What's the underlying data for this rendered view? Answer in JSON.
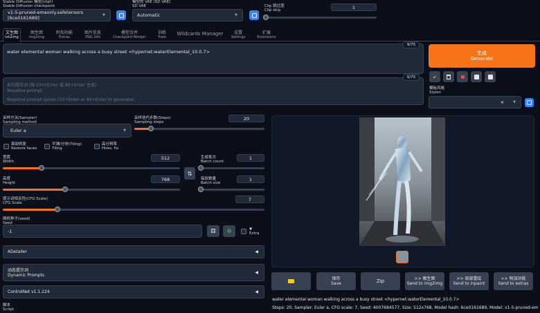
{
  "top": {
    "checkpoint_label_zh": "Stable Diffusion 模型(ckpt)",
    "checkpoint_label_en": "Stable Diffusion checkpoint",
    "checkpoint_value": "v1-5-pruned-emaonly.safetensors [6ce0161689]",
    "vae_label_zh": "模型的 VAE (SD VAE)",
    "vae_label_en": "SD VAE",
    "vae_value": "Automatic",
    "clip_label_zh": "Clip 跳过层",
    "clip_label_en": "Clip skip",
    "clip_value": "1",
    "clip_level": 0
  },
  "tabs": [
    {
      "zh": "文生图",
      "en": "txt2img"
    },
    {
      "zh": "图生图",
      "en": "img2img"
    },
    {
      "zh": "附加功能",
      "en": "Extras"
    },
    {
      "zh": "图片信息",
      "en": "PNG Info"
    },
    {
      "zh": "模型合并",
      "en": "Checkpoint Merger"
    },
    {
      "zh": "训练",
      "en": "Train"
    },
    {
      "zh": "Wildcards Manager",
      "en": ""
    },
    {
      "zh": "设置",
      "en": "Settings"
    },
    {
      "zh": "扩展",
      "en": "Extensions"
    }
  ],
  "prompt": {
    "text": "water elemental woman walking across a busy street <hypernet:waterElemental_10.0.7>",
    "counter": "9/75"
  },
  "negative": {
    "placeholder_zh": "反向提示词 (按 Ctrl+Enter 或 Alt+Enter 生成)",
    "placeholder_en": "Negative prompt",
    "hint": "Negative prompt (press Ctrl+Enter or Alt+Enter to generate)",
    "counter": "0/75"
  },
  "generate": {
    "zh": "生成",
    "en": "Generate",
    "color": "#f97316"
  },
  "styles": {
    "zh": "模板风格",
    "en": "Styles"
  },
  "sampling": {
    "method_zh": "采样方法(Sampler)",
    "method_en": "Sampling method",
    "method_value": "Euler a",
    "steps_zh": "采样迭代步数(Steps)",
    "steps_en": "Sampling steps",
    "steps_value": "20",
    "steps_level": 0.13
  },
  "checks": [
    {
      "zh": "面部修复",
      "en": "Restore faces"
    },
    {
      "zh": "平铺/分块(Tiling)",
      "en": "Tiling"
    },
    {
      "zh": "高分辨率",
      "en": "Hires. fix"
    }
  ],
  "width": {
    "zh": "宽度",
    "en": "Width",
    "value": "512",
    "level": 0.22
  },
  "height": {
    "zh": "高度",
    "en": "Height",
    "value": "768",
    "level": 0.35
  },
  "batch_count": {
    "zh": "生成批次",
    "en": "Batch count",
    "value": "1",
    "level": 0
  },
  "batch_size": {
    "zh": "每批数量",
    "en": "Batch size",
    "value": "1",
    "level": 0
  },
  "cfg": {
    "zh": "提示词相关性(CFG Scale)",
    "en": "CFG Scale",
    "value": "7",
    "level": 0.21
  },
  "seed": {
    "zh": "随机种子(seed)",
    "en": "Seed",
    "value": "-1",
    "extra": "Extra"
  },
  "accordions": [
    {
      "label": "ADetailer"
    },
    {
      "zh": "动态提示词",
      "label": "Dynamic Prompts"
    },
    {
      "label": "ControlNet v1.1.224"
    }
  ],
  "script": {
    "zh": "脚本",
    "en": "Script"
  },
  "actions": [
    {
      "zh": "",
      "en": "",
      "icon": "folder-icon"
    },
    {
      "zh": "保存",
      "en": "Save"
    },
    {
      "zh": "",
      "en": "Zip"
    },
    {
      "zh": ">> 图生图",
      "en": "Send to img2img"
    },
    {
      "zh": ">> 局部重绘",
      "en": "Send to inpaint"
    },
    {
      "zh": ">> 附加功能",
      "en": "Send to extras"
    }
  ],
  "info": {
    "line1": "water elemental woman walking across a busy street <hypernet:waterElemental_10.0.7>",
    "line2": "Steps: 20, Sampler: Euler a, CFG scale: 7, Seed: 4007684577, Size: 512x768, Model hash: 6ce0161689, Model: v1-5-pruned-emaonly,"
  }
}
